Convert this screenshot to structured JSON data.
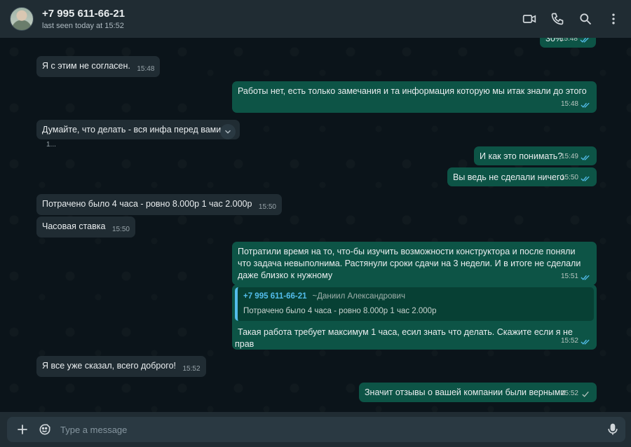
{
  "header": {
    "contact_name": "+7 995 611-66-21",
    "status": "last seen today at 15:52",
    "icons": [
      "video-call-icon",
      "voice-call-icon",
      "search-icon",
      "menu-icon"
    ]
  },
  "messages": [
    {
      "dir": "out",
      "text": "30%",
      "time": "15:48",
      "ticks": true
    },
    {
      "dir": "in",
      "text": "Я с этим не согласен.",
      "time": "15:48"
    },
    {
      "dir": "out",
      "text": "Работы нет, есть только замечания и та информация которую мы итак знали до этого",
      "time": "15:48",
      "ticks": true
    },
    {
      "dir": "in",
      "text": "Думайте, что делать - вся инфа перед вами.",
      "time": "1..."
    },
    {
      "dir": "out",
      "text": "И как это понимать?",
      "time": "15:49",
      "ticks": true
    },
    {
      "dir": "out",
      "text": "Вы ведь не сделали ничего",
      "time": "15:50",
      "ticks": true
    },
    {
      "dir": "in",
      "text": "Потрачено было 4 часа - ровно 8.000р 1 час 2.000р",
      "time": "15:50"
    },
    {
      "dir": "in",
      "text": "Часовая ставка",
      "time": "15:50"
    },
    {
      "dir": "out",
      "text": "Потратили время на то, что-бы изучить возможности конструктора и после поняли что задача невыполнима. Растянули сроки сдачи на 3 недели. И в итоге не сделали даже близко к нужному",
      "time": "15:51",
      "ticks": true
    },
    {
      "dir": "out",
      "quote": {
        "phone": "+7 995 611-66-21",
        "author": "~Даниил Александрович",
        "text": "Потрачено было 4 часа - ровно 8.000р 1 час 2.000р"
      },
      "text": "Такая работа требует максимум 1 часа, есил знать что делать. Скажите если я не прав",
      "time": "15:52",
      "ticks": true
    },
    {
      "dir": "in",
      "text": "Я все уже сказал, всего доброго!",
      "time": "15:52"
    },
    {
      "dir": "out",
      "text": "Значит отзывы о вашей компании были верными",
      "time": "15:52",
      "ticks": true
    }
  ],
  "composer": {
    "placeholder": "Type a message"
  },
  "colors": {
    "header_bg": "#202c33",
    "chat_bg": "#0b141a",
    "incoming_bubble": "#202c33",
    "outgoing_bubble": "#0d5446",
    "read_ticks": "#53bdeb",
    "quote_accent": "#53bdeb"
  }
}
